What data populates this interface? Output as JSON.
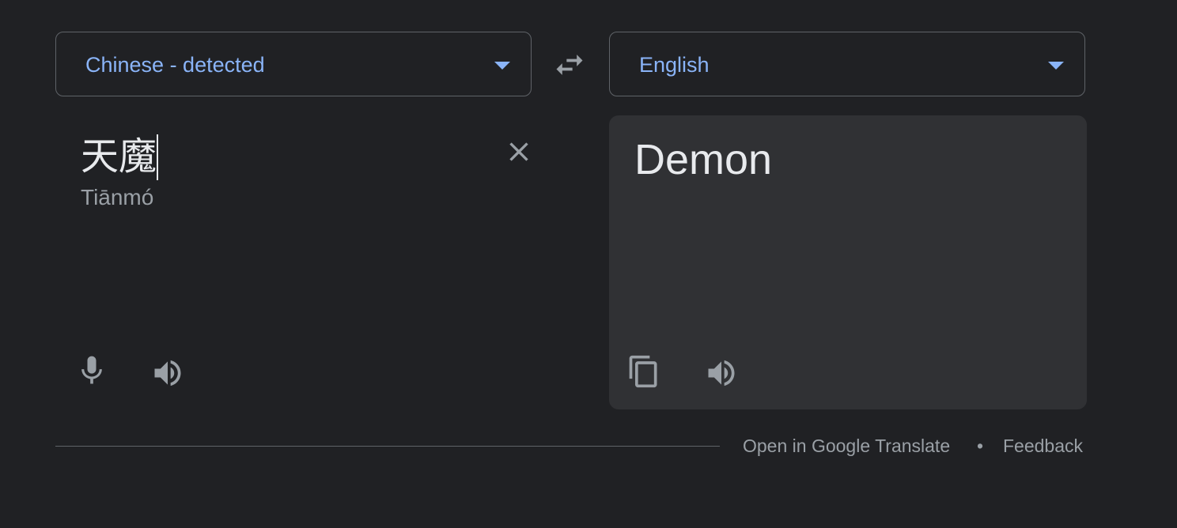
{
  "source_language": {
    "label": "Chinese - detected"
  },
  "target_language": {
    "label": "English"
  },
  "source": {
    "text": "天魔",
    "transliteration": "Tiānmó"
  },
  "target": {
    "text": "Demon"
  },
  "footer": {
    "open_link": "Open in Google Translate",
    "separator": "•",
    "feedback_link": "Feedback"
  },
  "colors": {
    "background": "#202124",
    "accent": "#8ab4f8",
    "panel": "#303134",
    "icon": "#9aa0a6"
  },
  "icons": {
    "swap": "swap-arrows-icon",
    "clear": "close-icon",
    "mic": "microphone-icon",
    "listen": "speaker-icon",
    "copy": "copy-icon"
  }
}
